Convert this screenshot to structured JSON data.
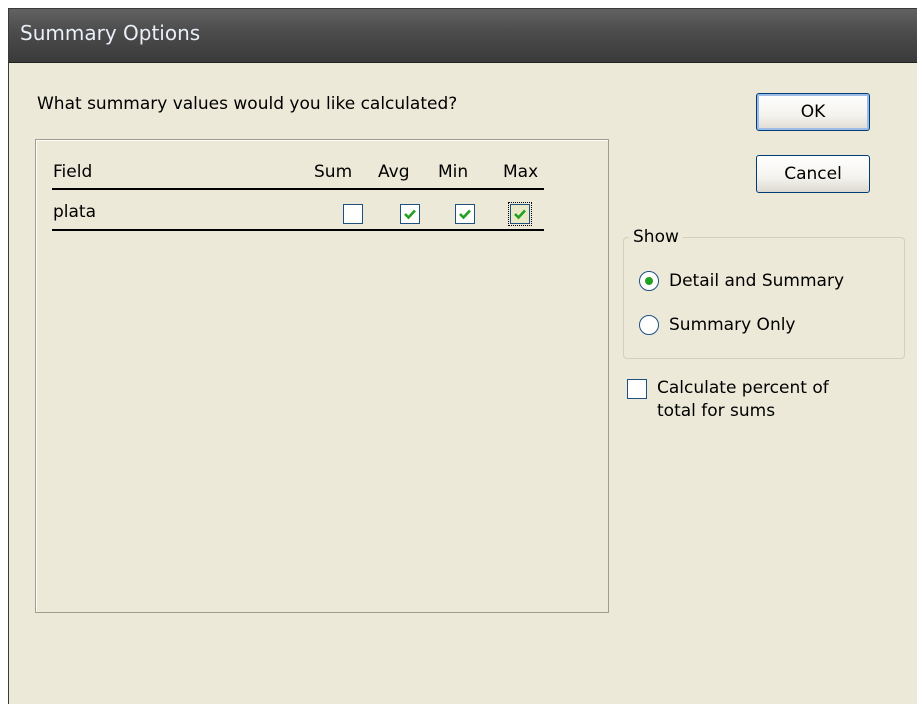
{
  "dialog": {
    "title": "Summary Options",
    "prompt": "What summary values would you like calculated?"
  },
  "grid": {
    "headers": {
      "field": "Field",
      "sum": "Sum",
      "avg": "Avg",
      "min": "Min",
      "max": "Max"
    },
    "rows": [
      {
        "field": "plata",
        "sum": false,
        "avg": true,
        "min": true,
        "max": true
      }
    ]
  },
  "buttons": {
    "ok": "OK",
    "cancel": "Cancel"
  },
  "show": {
    "legend": "Show",
    "options": [
      {
        "label": "Detail and Summary",
        "selected": true
      },
      {
        "label": "Summary Only",
        "selected": false
      }
    ]
  },
  "percent": {
    "label_line1": "Calculate percent of",
    "label_line2": "total for sums",
    "checked": false
  },
  "colors": {
    "check": "#21a121",
    "border": "#1c5180",
    "face": "#ece9d8"
  }
}
